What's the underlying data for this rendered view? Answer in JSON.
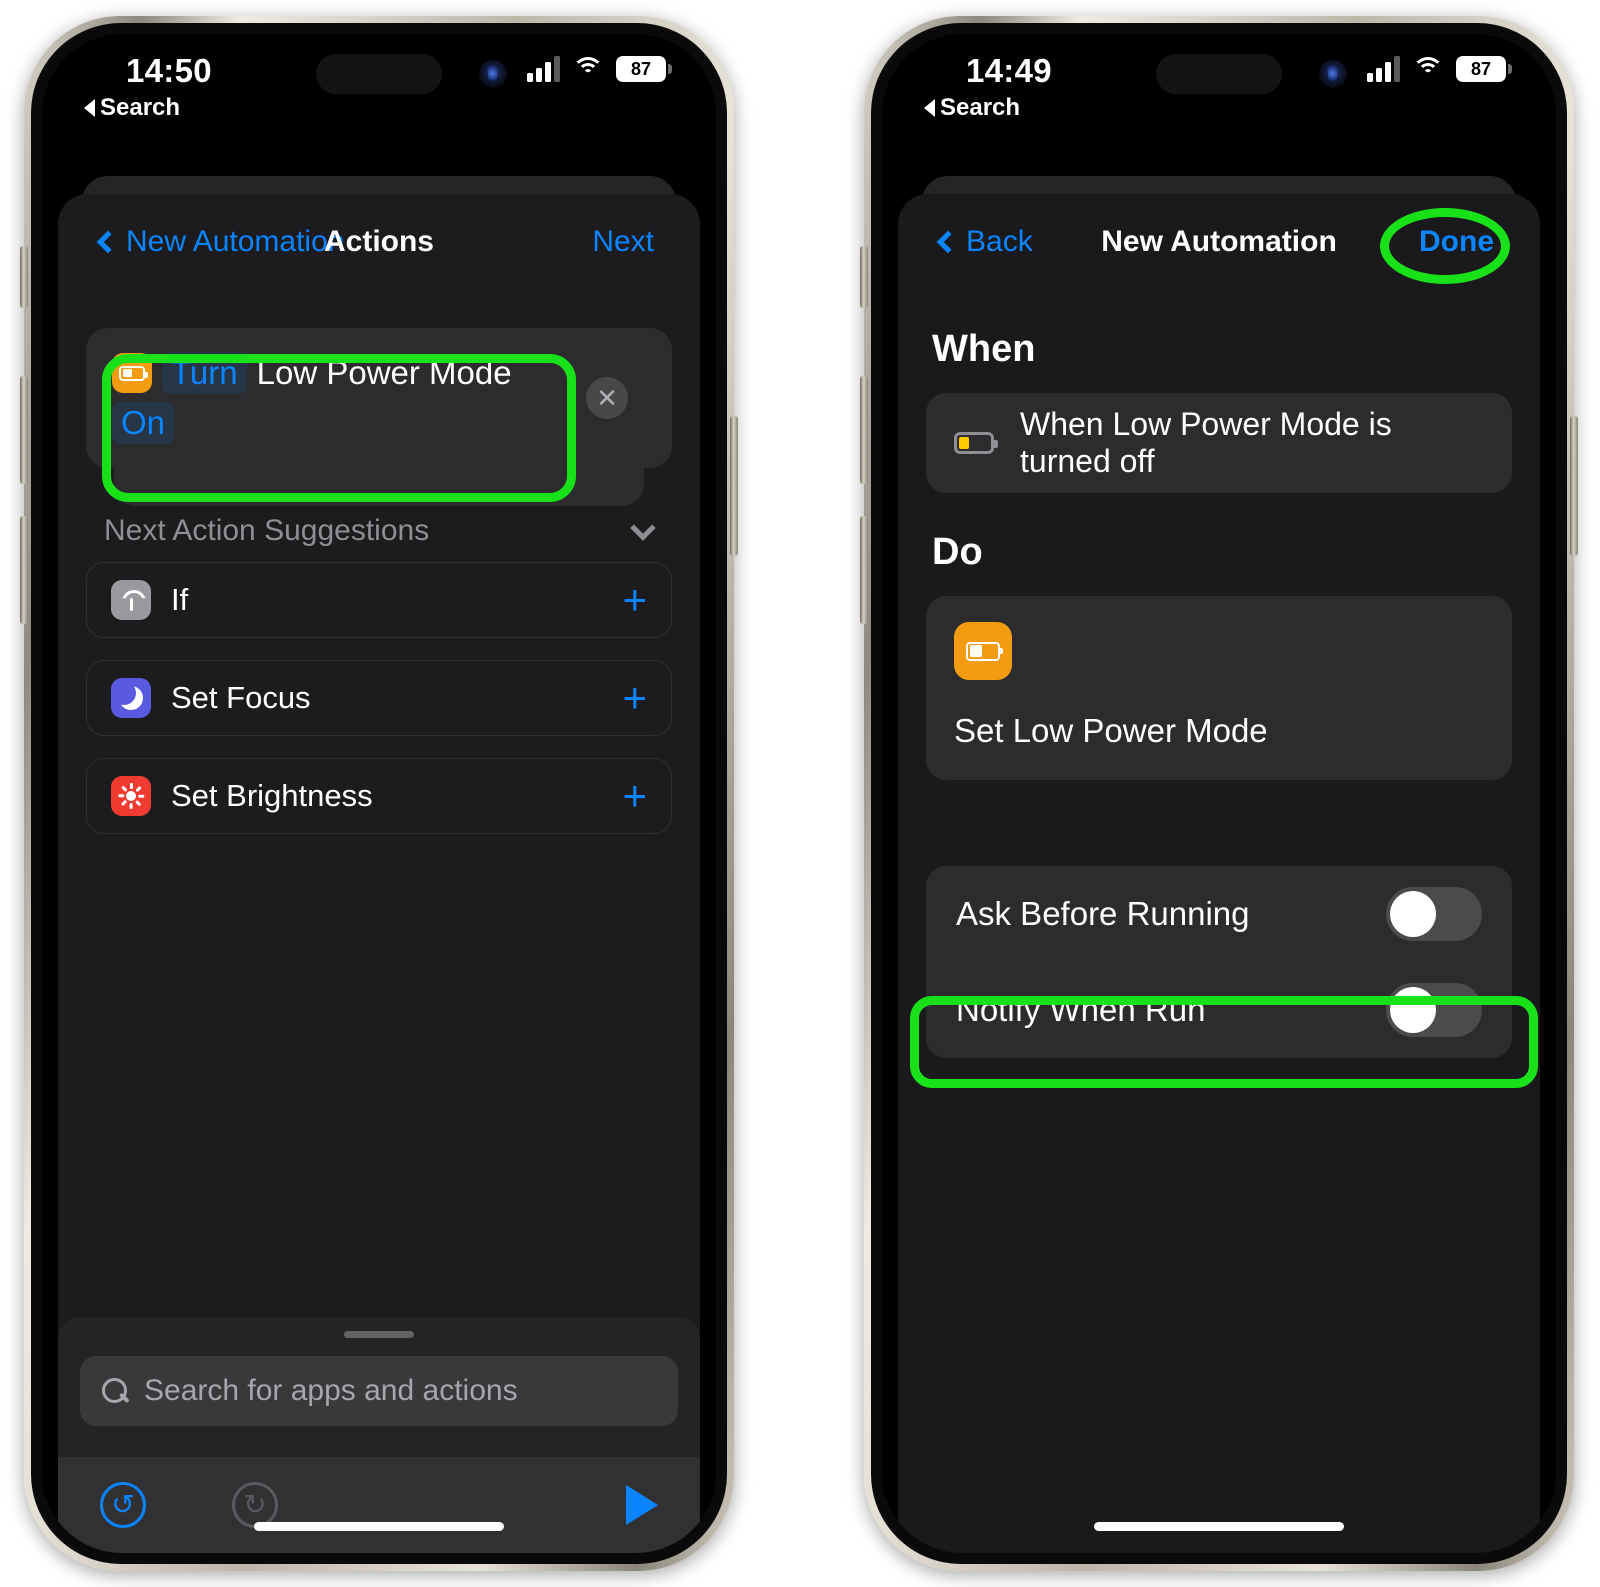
{
  "left_phone": {
    "status": {
      "time": "14:50",
      "back_app": "Search",
      "battery": "87"
    },
    "nav": {
      "back_label": "New Automation",
      "title": "Actions",
      "next_label": "Next"
    },
    "action": {
      "icon": "low-power-mode-icon",
      "turn_token": "Turn",
      "subject": "Low Power Mode",
      "state_token": "On",
      "remove_label": "✕"
    },
    "suggestions": {
      "header": "Next Action Suggestions",
      "items": [
        {
          "label": "If",
          "icon": "if-branch-icon",
          "add": "+"
        },
        {
          "label": "Set Focus",
          "icon": "focus-moon-icon",
          "add": "+"
        },
        {
          "label": "Set Brightness",
          "icon": "brightness-sun-icon",
          "add": "+"
        }
      ]
    },
    "search": {
      "placeholder": "Search for apps and actions"
    },
    "toolbar": {
      "undo": "↺",
      "redo": "↻"
    }
  },
  "right_phone": {
    "status": {
      "time": "14:49",
      "back_app": "Search",
      "battery": "87"
    },
    "nav": {
      "back_label": "Back",
      "title": "New Automation",
      "done_label": "Done"
    },
    "when": {
      "section_title": "When",
      "trigger_text": "When Low Power Mode is turned off",
      "icon": "battery-low-icon"
    },
    "do": {
      "section_title": "Do",
      "action_label": "Set Low Power Mode",
      "icon": "low-power-mode-icon"
    },
    "options": [
      {
        "label": "Ask Before Running",
        "value": "off"
      },
      {
        "label": "Notify When Run",
        "value": "off"
      }
    ]
  },
  "highlights": {
    "color": "#19e119"
  }
}
